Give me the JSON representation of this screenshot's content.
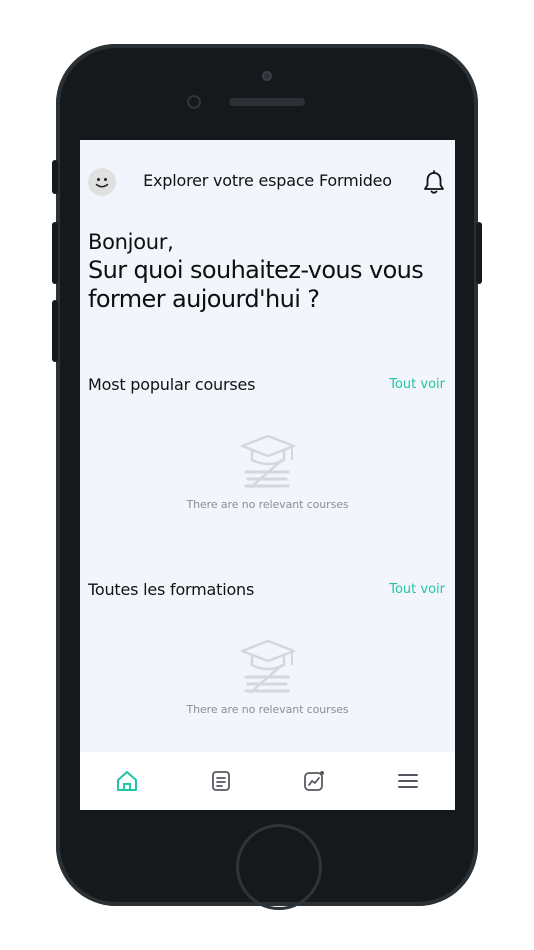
{
  "header": {
    "title": "Explorer votre espace Formideo",
    "avatar_icon": "smiley-avatar-icon",
    "notification_icon": "bell-icon"
  },
  "greeting": {
    "line1": "Bonjour,",
    "line2": "Sur quoi souhaitez-vous vous former aujourd'hui ?"
  },
  "sections": [
    {
      "title": "Most popular courses",
      "see_all": "Tout voir",
      "empty_message": "There are no relevant courses",
      "empty_icon": "graduation-cap-books-icon"
    },
    {
      "title": "Toutes les formations",
      "see_all": "Tout voir",
      "empty_message": "There are no relevant courses",
      "empty_icon": "graduation-cap-books-icon"
    }
  ],
  "bottom_nav": [
    {
      "icon": "home-icon",
      "active": true
    },
    {
      "icon": "document-icon",
      "active": false
    },
    {
      "icon": "chart-icon",
      "active": false
    },
    {
      "icon": "menu-icon",
      "active": false
    }
  ],
  "colors": {
    "accent": "#1fc7a5",
    "screen_bg": "#f2f5fb",
    "phone_frame": "#15191c",
    "muted_text": "#8c8f96"
  }
}
